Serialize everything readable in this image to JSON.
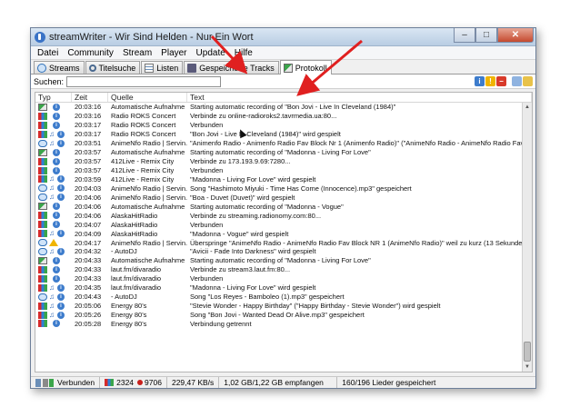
{
  "window": {
    "title": "streamWriter - Wir Sind Helden - Nur Ein Wort",
    "minimize": "–",
    "maximize": "□",
    "close": "✕"
  },
  "menu": [
    "Datei",
    "Community",
    "Stream",
    "Player",
    "Update",
    "Hilfe"
  ],
  "tabs": [
    {
      "label": "Streams",
      "icon": "radio-icon"
    },
    {
      "label": "Titelsuche",
      "icon": "search-icon"
    },
    {
      "label": "Listen",
      "icon": "list-icon"
    },
    {
      "label": "Gespeicherte Tracks",
      "icon": "disk-icon"
    },
    {
      "label": "Protokoll",
      "icon": "log-icon",
      "active": true
    }
  ],
  "search": {
    "label": "Suchen:",
    "value": ""
  },
  "columns": {
    "type": "Typ",
    "time": "Zeit",
    "source": "Quelle",
    "text": "Text"
  },
  "rows": [
    {
      "type": "auto",
      "time": "20:03:16",
      "source": "Automatische Aufnahme",
      "text": "Starting automatic recording of \"Bon Jovi - Live In Cleveland (1984)\""
    },
    {
      "type": "blocks",
      "time": "20:03:16",
      "source": "Radio ROKS Concert",
      "text": "Verbinde zu online-radioroks2.tavrmedia.ua:80..."
    },
    {
      "type": "blocks",
      "time": "20:03:17",
      "source": "Radio ROKS Concert",
      "text": "Verbunden"
    },
    {
      "type": "blocks-note",
      "time": "20:03:17",
      "source": "Radio ROKS Concert",
      "text": "\"Bon Jovi - Live In Cleveland (1984)\" wird gespielt"
    },
    {
      "type": "radio-note",
      "time": "20:03:51",
      "source": "AnimeNfo Radio | Servin...",
      "text": "\"Animenfo Radio - Animenfo Radio Fav Block Nr 1 (Animenfo Radio)\" (\"AnimeNfo Radio - AnimeNfo Radio Fav Block N..."
    },
    {
      "type": "auto",
      "time": "20:03:57",
      "source": "Automatische Aufnahme",
      "text": "Starting automatic recording of \"Madonna - Living For Love\""
    },
    {
      "type": "blocks",
      "time": "20:03:57",
      "source": "412Live - Remix City",
      "text": "Verbinde zu 173.193.9.69:7280..."
    },
    {
      "type": "blocks",
      "time": "20:03:57",
      "source": "412Live - Remix City",
      "text": "Verbunden"
    },
    {
      "type": "blocks-note",
      "time": "20:03:59",
      "source": "412Live - Remix City",
      "text": "\"Madonna - Living For Love\" wird gespielt"
    },
    {
      "type": "radio-note",
      "time": "20:04:03",
      "source": "AnimeNfo Radio | Servin...",
      "text": "Song \"Hashimoto Miyuki - Time Has Come (Innocence).mp3\" gespeichert"
    },
    {
      "type": "radio-note",
      "time": "20:04:06",
      "source": "AnimeNfo Radio | Servin...",
      "text": "\"Boa - Duvet (Duvet)\" wird gespielt"
    },
    {
      "type": "auto",
      "time": "20:04:06",
      "source": "Automatische Aufnahme",
      "text": "Starting automatic recording of \"Madonna - Vogue\""
    },
    {
      "type": "blocks",
      "time": "20:04:06",
      "source": "AlaskaHitRadio",
      "text": "Verbinde zu streaming.radionomy.com:80..."
    },
    {
      "type": "blocks",
      "time": "20:04:07",
      "source": "AlaskaHitRadio",
      "text": "Verbunden"
    },
    {
      "type": "blocks-note",
      "time": "20:04:09",
      "source": "AlaskaHitRadio",
      "text": "\"Madonna - Vogue\" wird gespielt"
    },
    {
      "type": "radio-warn",
      "time": "20:04:17",
      "source": "AnimeNfo Radio | Servin...",
      "text": "Überspringe \"AnimeNfo Radio - AnimeNfo Radio Fav Block NR 1 (AnimeNfo Radio)\" weil zu kurz (13 Sekunden)"
    },
    {
      "type": "radio-note",
      "time": "20:04:32",
      "source": "- AutoDJ",
      "text": "\"Avicii - Fade Into Darkness\" wird gespielt"
    },
    {
      "type": "auto",
      "time": "20:04:33",
      "source": "Automatische Aufnahme",
      "text": "Starting automatic recording of \"Madonna - Living For Love\""
    },
    {
      "type": "blocks",
      "time": "20:04:33",
      "source": "laut.fm/divaradio",
      "text": "Verbinde zu stream3.laut.fm:80..."
    },
    {
      "type": "blocks",
      "time": "20:04:33",
      "source": "laut.fm/divaradio",
      "text": "Verbunden"
    },
    {
      "type": "blocks-note",
      "time": "20:04:35",
      "source": "laut.fm/divaradio",
      "text": "\"Madonna - Living For Love\" wird gespielt"
    },
    {
      "type": "radio-note",
      "time": "20:04:43",
      "source": "- AutoDJ",
      "text": "Song \"Los Reyes - Bamboleo (1).mp3\" gespeichert"
    },
    {
      "type": "blocks-note",
      "time": "20:05:06",
      "source": "Energy 80's",
      "text": "\"Stevie Wonder - Happy Birthday\" (\"Happy Birthday - Stevie Wonder\") wird gespielt"
    },
    {
      "type": "blocks-note",
      "time": "20:05:26",
      "source": "Energy 80's",
      "text": "Song \"Bon Jovi - Wanted Dead Or Alive.mp3\" gespeichert"
    },
    {
      "type": "blocks",
      "time": "20:05:28",
      "source": "Energy 80's",
      "text": "Verbindung getrennt"
    }
  ],
  "status": {
    "connection": "Verbunden",
    "listeners": "2324",
    "records": "9706",
    "speed": "229,47 KB/s",
    "received": "1,02 GB/1,22 GB empfangen",
    "saved": "160/196 Lieder gespeichert"
  },
  "colors": {
    "annotation_arrow": "#e02020",
    "accent": "#3a73c6"
  }
}
